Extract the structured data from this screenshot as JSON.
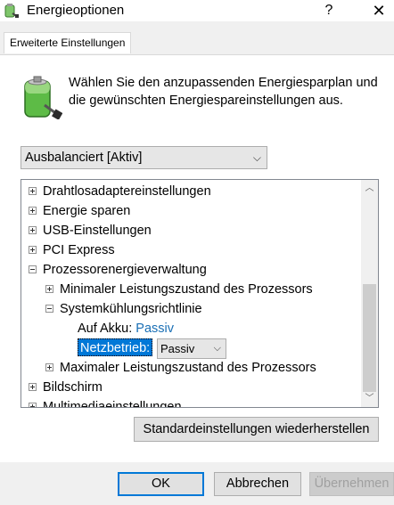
{
  "window": {
    "title": "Energieoptionen",
    "help_label": "?",
    "close_label": "✕"
  },
  "tab": {
    "label": "Erweiterte Einstellungen"
  },
  "intro": {
    "text": "Wählen Sie den anzupassenden Energiesparplan und die gewünschten Energiespareinstellungen aus."
  },
  "plan_select": {
    "value": "Ausbalanciert [Aktiv]",
    "chevron": "⌵"
  },
  "tree": {
    "items": [
      {
        "label": "Drahtlosadaptereinstellungen",
        "expander": "plus"
      },
      {
        "label": "Energie sparen",
        "expander": "plus"
      },
      {
        "label": "USB-Einstellungen",
        "expander": "plus"
      },
      {
        "label": "PCI Express",
        "expander": "plus"
      },
      {
        "label": "Prozessorenergieverwaltung",
        "expander": "minus"
      },
      {
        "label": "Minimaler Leistungszustand des Prozessors",
        "expander": "plus"
      },
      {
        "label": "Systemkühlungsrichtlinie",
        "expander": "minus"
      },
      {
        "label": "Maximaler Leistungszustand des Prozessors",
        "expander": "plus"
      },
      {
        "label": "Bildschirm",
        "expander": "plus"
      },
      {
        "label": "Multimediaeinstellungen",
        "expander": "plus"
      }
    ],
    "battery_setting": {
      "label": "Auf Akku:",
      "value": "Passiv"
    },
    "ac_setting": {
      "label": "Netzbetrieb:",
      "value": "Passiv",
      "chevron": "⌵"
    },
    "scroll_up": "︿",
    "scroll_down": "﹀"
  },
  "restore_button": {
    "label": "Standardeinstellungen wiederherstellen"
  },
  "footer": {
    "ok_label": "OK",
    "cancel_label": "Abbrechen",
    "apply_label": "Übernehmen"
  },
  "colors": {
    "accent": "#0078d7",
    "link": "#1a6fb5",
    "disabled_text": "#a0a0a0"
  }
}
